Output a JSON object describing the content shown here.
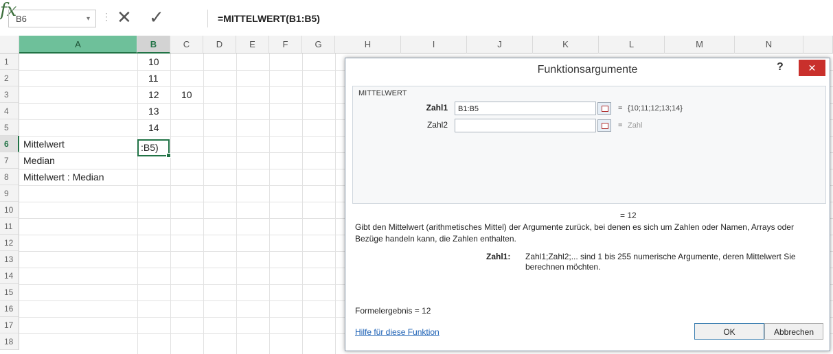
{
  "formula_bar": {
    "name_box": "B6",
    "dots": "⋮",
    "cancel": "✕",
    "enter": "✓",
    "fx": "fx",
    "formula": "=MITTELWERT(B1:B5)"
  },
  "columns": [
    "A",
    "B",
    "C",
    "D",
    "E",
    "F",
    "G",
    "H",
    "I",
    "J",
    "K",
    "L",
    "M",
    "N"
  ],
  "rows": [
    "1",
    "2",
    "3",
    "4",
    "5",
    "6",
    "7",
    "8",
    "9",
    "10",
    "11",
    "12",
    "13",
    "14",
    "15",
    "16",
    "17",
    "18"
  ],
  "cells": {
    "B1": "10",
    "B2": "11",
    "B3": "12",
    "C3": "10",
    "B4": "13",
    "B5": "14",
    "A6": "Mittelwert",
    "B6": ":B5)",
    "A7": "Median",
    "A8": "Mittelwert : Median"
  },
  "dialog": {
    "title": "Funktionsargumente",
    "help": "?",
    "close": "✕",
    "function_name": "MITTELWERT",
    "args": [
      {
        "label": "Zahl1",
        "value": "B1:B5",
        "eq": "=",
        "result": "{10;11;12;13;14}"
      },
      {
        "label": "Zahl2",
        "value": "",
        "eq": "=",
        "result": "Zahl"
      }
    ],
    "function_result": "= 12",
    "description": "Gibt den Mittelwert (arithmetisches Mittel) der Argumente zurück, bei denen es sich um Zahlen oder Namen, Arrays oder Bezüge handeln kann, die Zahlen enthalten.",
    "arg_desc_label": "Zahl1:",
    "arg_desc": "Zahl1;Zahl2;... sind 1 bis 255 numerische Argumente, deren Mittelwert Sie berechnen möchten.",
    "formula_result": "Formelergebnis =  12",
    "help_link": "Hilfe für diese Funktion",
    "ok": "OK",
    "cancel": "Abbrechen"
  },
  "colors": {
    "excel_green": "#217346",
    "close_red": "#c9302c",
    "link_blue": "#1a5fb4"
  }
}
